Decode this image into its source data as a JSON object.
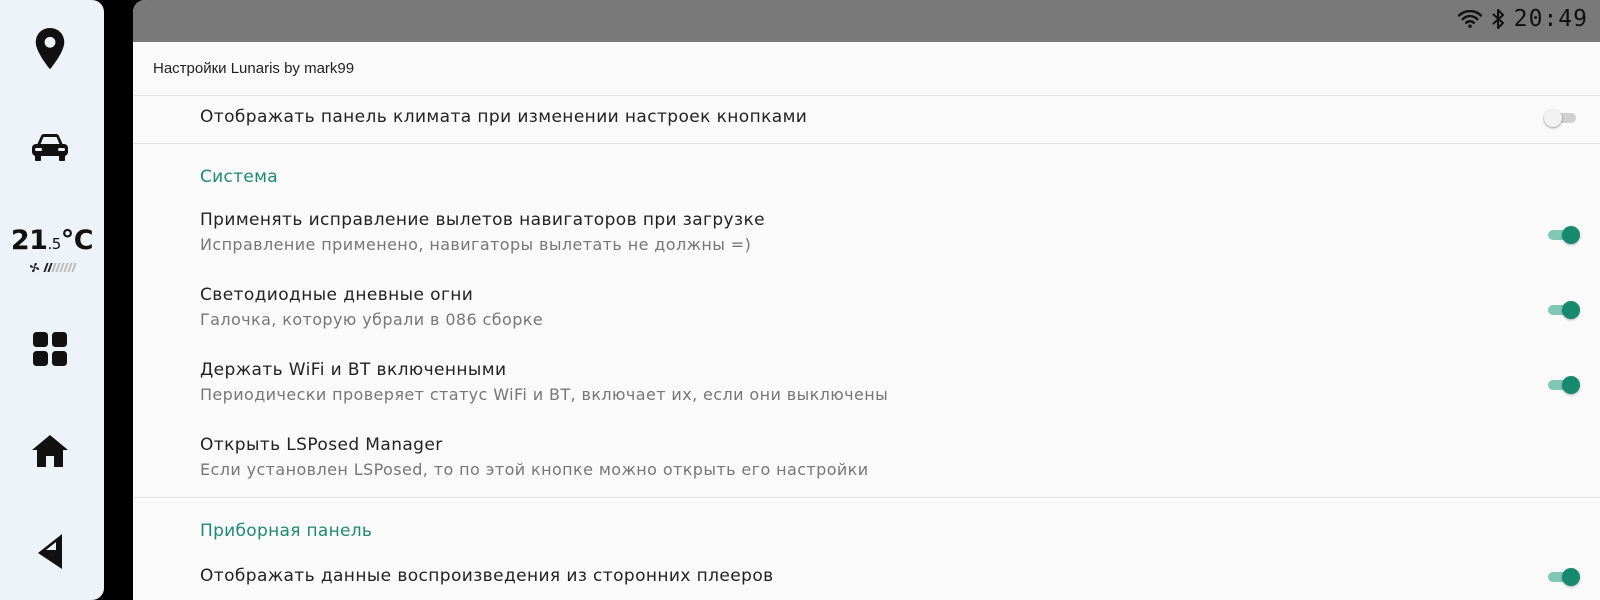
{
  "rail": {
    "items": [
      {
        "name": "navigation",
        "icon": "map-pin-icon"
      },
      {
        "name": "car",
        "icon": "car-icon"
      },
      {
        "name": "apps",
        "icon": "apps-grid-icon"
      },
      {
        "name": "home",
        "icon": "home-icon"
      },
      {
        "name": "media",
        "icon": "media-icon"
      }
    ],
    "climate": {
      "temp_int": "21",
      "temp_dec": ".5",
      "unit": "°C",
      "fan_icon": "fan-icon",
      "fan_level": 2,
      "fan_max": 8
    }
  },
  "statusbar": {
    "time": "20:49",
    "icons": [
      "wifi-icon",
      "bluetooth-icon"
    ]
  },
  "appbar": {
    "title": "Настройки Lunaris by mark99"
  },
  "prefs": {
    "climate_panel": {
      "title": "Отображать панель климата при изменении настроек кнопками",
      "enabled": false
    },
    "system_category": "Система",
    "nav_crash_fix": {
      "title": "Применять исправление вылетов навигаторов при загрузке",
      "summary": "Исправление применено, навигаторы вылетать не должны =)",
      "enabled": true
    },
    "drl": {
      "title": "Светодиодные дневные огни",
      "summary": "Галочка, которую убрали в 086 сборке",
      "enabled": true
    },
    "keep_wifi_bt": {
      "title": "Держать WiFi и BT включенными",
      "summary": "Периодически проверяет статус WiFi и BT, включает их, если они выключены",
      "enabled": true
    },
    "lsposed": {
      "title": "Открыть LSPosed Manager",
      "summary": "Если установлен LSPosed, то по этой кнопке можно открыть его настройки"
    },
    "dashboard_category": "Приборная панель",
    "third_party_players": {
      "title": "Отображать данные воспроизведения из сторонних плееров",
      "enabled": true
    }
  },
  "colors": {
    "accent": "#1f8a70",
    "switch_on": "#168a6f",
    "statusbar": "#797979",
    "rail": "#eef2f9"
  }
}
